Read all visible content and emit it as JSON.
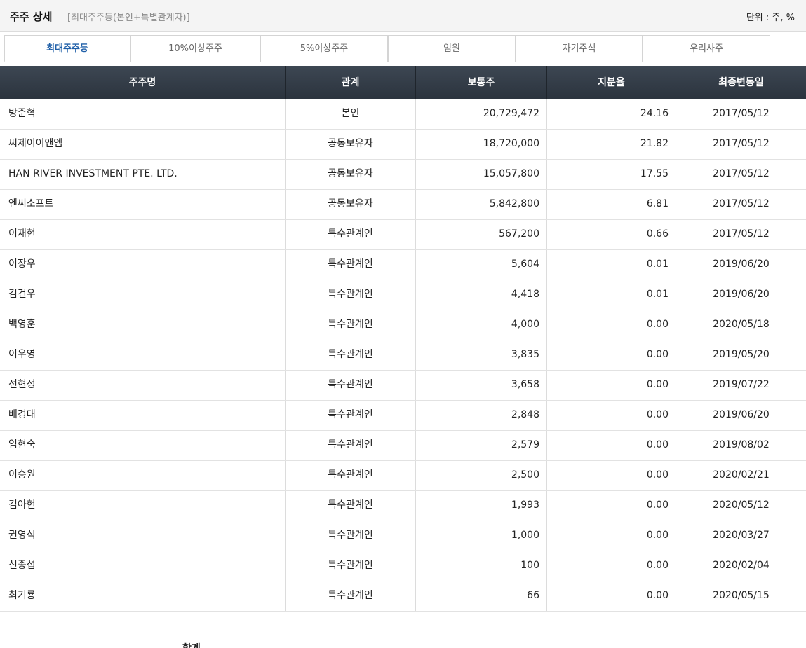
{
  "header": {
    "title": "주주 상세",
    "subtitle": "[최대주주등(본인+특별관계자)]",
    "unit": "단위 : 주, %"
  },
  "tabs": [
    {
      "label": "최대주주등",
      "active": true
    },
    {
      "label": "10%이상주주",
      "active": false
    },
    {
      "label": "5%이상주주",
      "active": false
    },
    {
      "label": "임원",
      "active": false
    },
    {
      "label": "자기주식",
      "active": false
    },
    {
      "label": "우리사주",
      "active": false
    }
  ],
  "table": {
    "columns": [
      "주주명",
      "관계",
      "보통주",
      "지분율",
      "최종변동일"
    ],
    "rows": [
      {
        "name": "방준혁",
        "relation": "본인",
        "shares": "20,729,472",
        "ratio": "24.16",
        "date": "2017/05/12"
      },
      {
        "name": "씨제이이앤엠",
        "relation": "공동보유자",
        "shares": "18,720,000",
        "ratio": "21.82",
        "date": "2017/05/12"
      },
      {
        "name": "HAN RIVER INVESTMENT PTE. LTD.",
        "relation": "공동보유자",
        "shares": "15,057,800",
        "ratio": "17.55",
        "date": "2017/05/12"
      },
      {
        "name": "엔씨소프트",
        "relation": "공동보유자",
        "shares": "5,842,800",
        "ratio": "6.81",
        "date": "2017/05/12"
      },
      {
        "name": "이재현",
        "relation": "특수관계인",
        "shares": "567,200",
        "ratio": "0.66",
        "date": "2017/05/12"
      },
      {
        "name": "이장우",
        "relation": "특수관계인",
        "shares": "5,604",
        "ratio": "0.01",
        "date": "2019/06/20"
      },
      {
        "name": "김건우",
        "relation": "특수관계인",
        "shares": "4,418",
        "ratio": "0.01",
        "date": "2019/06/20"
      },
      {
        "name": "백영훈",
        "relation": "특수관계인",
        "shares": "4,000",
        "ratio": "0.00",
        "date": "2020/05/18"
      },
      {
        "name": "이우영",
        "relation": "특수관계인",
        "shares": "3,835",
        "ratio": "0.00",
        "date": "2019/05/20"
      },
      {
        "name": "전현정",
        "relation": "특수관계인",
        "shares": "3,658",
        "ratio": "0.00",
        "date": "2019/07/22"
      },
      {
        "name": "배경태",
        "relation": "특수관계인",
        "shares": "2,848",
        "ratio": "0.00",
        "date": "2019/06/20"
      },
      {
        "name": "임현숙",
        "relation": "특수관계인",
        "shares": "2,579",
        "ratio": "0.00",
        "date": "2019/08/02"
      },
      {
        "name": "이승원",
        "relation": "특수관계인",
        "shares": "2,500",
        "ratio": "0.00",
        "date": "2020/02/21"
      },
      {
        "name": "김아현",
        "relation": "특수관계인",
        "shares": "1,993",
        "ratio": "0.00",
        "date": "2020/05/12"
      },
      {
        "name": "권영식",
        "relation": "특수관계인",
        "shares": "1,000",
        "ratio": "0.00",
        "date": "2020/03/27"
      },
      {
        "name": "신종섭",
        "relation": "특수관계인",
        "shares": "100",
        "ratio": "0.00",
        "date": "2020/02/04"
      },
      {
        "name": "최기룡",
        "relation": "특수관계인",
        "shares": "66",
        "ratio": "0.00",
        "date": "2020/05/15"
      }
    ],
    "total_label": "합계"
  }
}
